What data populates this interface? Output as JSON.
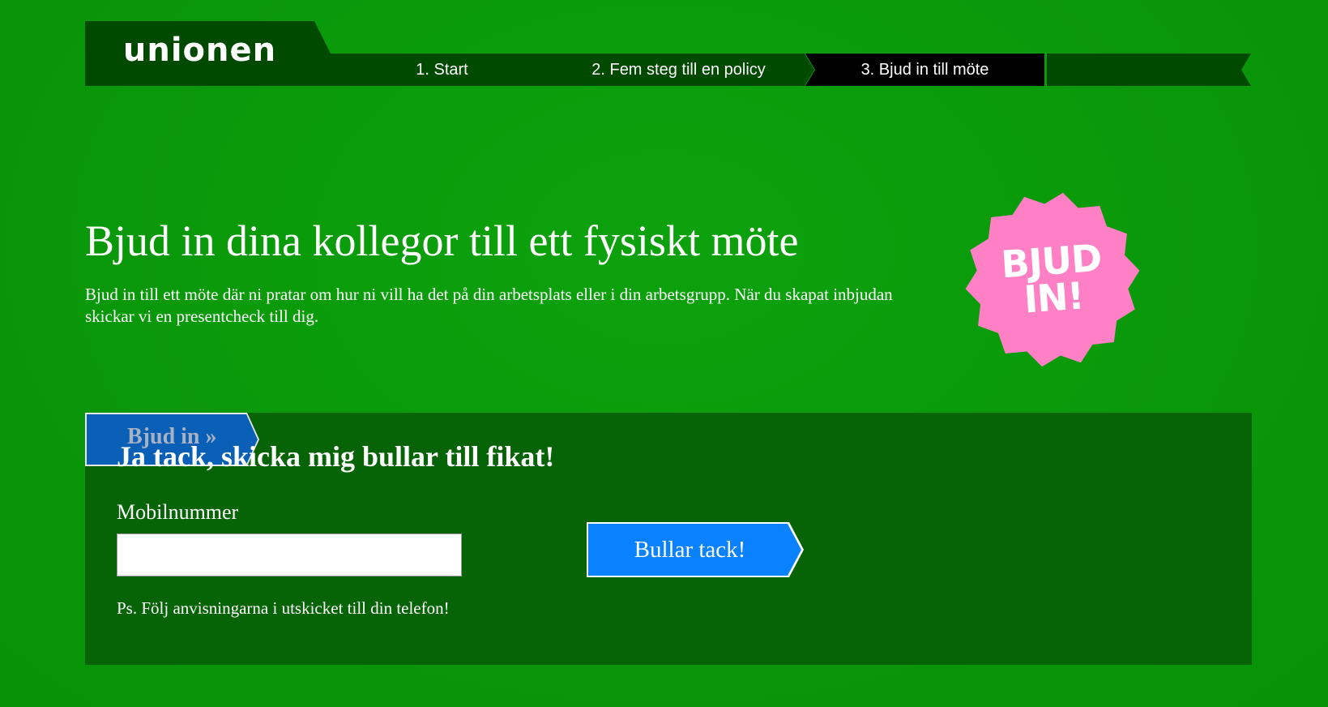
{
  "header": {
    "logo_text": "unionen",
    "steps": [
      {
        "label": "1. Start",
        "active": false
      },
      {
        "label": "2. Fem steg till en policy",
        "active": false
      },
      {
        "label": "3. Bjud in till möte",
        "active": true
      }
    ]
  },
  "hero": {
    "title": "Bjud in dina kollegor till ett fysiskt möte",
    "text": "Bjud in till ett möte där ni pratar om hur ni vill ha det på din arbetsplats eller i din arbetsgrupp. När du skapat inbjudan skickar vi en presentcheck till dig.",
    "badge": {
      "line1": "BJUD",
      "line2": "IN!",
      "color": "#ff80c4"
    }
  },
  "form": {
    "tab_label": "Bjud in »",
    "title": "Ja tack, skicka mig bullar till fikat!",
    "mobile_label": "Mobilnummer",
    "mobile_value": "",
    "submit_label": "Bullar tack!",
    "ps_text": "Ps. Följ anvisningarna i utskicket till din telefon!"
  },
  "colors": {
    "background": "#0a9a0a",
    "nav_dark": "#004a00",
    "nav_active": "#000000",
    "panel": "#066306",
    "tab_blue": "#0a5fb6",
    "button_blue": "#0a82ff",
    "badge_pink": "#ff80c4"
  }
}
